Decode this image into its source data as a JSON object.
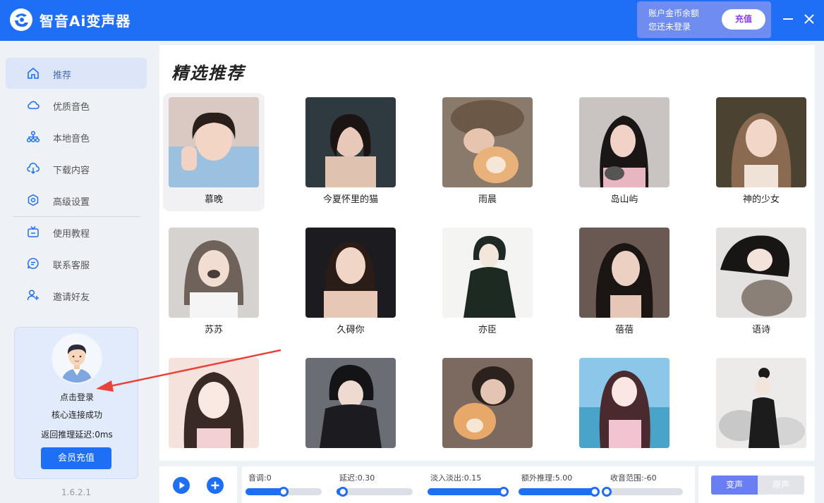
{
  "app": {
    "title": "智音Ai变声器",
    "accent_color": "#1e6ff5"
  },
  "account": {
    "line1": "账户金币余额",
    "line2": "您还未登录",
    "recharge_label": "充值"
  },
  "sidebar": {
    "items": [
      {
        "label": "推荐",
        "icon": "home-icon",
        "active": true
      },
      {
        "label": "优质音色",
        "icon": "cloud-icon"
      },
      {
        "label": "本地音色",
        "icon": "network-icon"
      },
      {
        "label": "下载内容",
        "icon": "download-icon"
      },
      {
        "label": "高级设置",
        "icon": "settings-icon"
      },
      {
        "label": "使用教程",
        "icon": "tv-icon"
      },
      {
        "label": "联系客服",
        "icon": "chat-icon"
      },
      {
        "label": "邀请好友",
        "icon": "add-user-icon"
      }
    ],
    "login": {
      "login_label": "点击登录",
      "status": "核心连接成功",
      "latency": "返回推理延迟:0ms",
      "vip_label": "会员充值"
    },
    "version": "1.6.2.1"
  },
  "main": {
    "title": "精选推荐",
    "voices": [
      {
        "name": "慕晚",
        "selected": true
      },
      {
        "name": "今夏怀里的猫"
      },
      {
        "name": "雨晨"
      },
      {
        "name": "岛山屿"
      },
      {
        "name": "神的少女"
      },
      {
        "name": "苏苏"
      },
      {
        "name": "久碍你"
      },
      {
        "name": "亦臣"
      },
      {
        "name": "蓓蓓"
      },
      {
        "name": "语诗"
      },
      {
        "name": ""
      },
      {
        "name": ""
      },
      {
        "name": ""
      },
      {
        "name": ""
      },
      {
        "name": ""
      }
    ]
  },
  "controls": {
    "sliders": [
      {
        "label": "音调:0",
        "fraction": 0.5
      },
      {
        "label": "延迟:0.30",
        "fraction": 0.08
      },
      {
        "label": "淡入淡出:0.15",
        "fraction": 1.0
      },
      {
        "label": "额外推理:5.00",
        "fraction": 1.0
      },
      {
        "label": "收音范围:-60",
        "fraction": 0.0
      }
    ],
    "mode_on": "变声",
    "mode_off": "原声"
  }
}
